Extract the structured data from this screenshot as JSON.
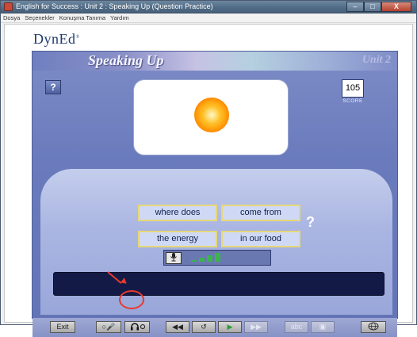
{
  "window": {
    "title": "English for Success : Unit 2 : Speaking Up (Question Practice)",
    "controls": {
      "minimize": "–",
      "maximize": "□",
      "close": "X"
    }
  },
  "menu": {
    "items": [
      "Dosya",
      "Seçenekler",
      "Konuşma Tanıma",
      "Yardım"
    ]
  },
  "brand": {
    "logo": "DynEd",
    "logo_mark": "®"
  },
  "lesson": {
    "title": "Speaking Up",
    "unit": "Unit 2",
    "help_label": "?",
    "score": {
      "value": "105",
      "label": "SCORE"
    },
    "picture": "sun",
    "phrases": [
      "where does",
      "come from",
      "the energy",
      "in our food"
    ],
    "question_mark": "?",
    "voice_level_bars": 4
  },
  "toolbar": {
    "exit_label": "Exit",
    "rewind_label": "◀◀",
    "repeat_label": "↺",
    "play_label": "▶",
    "forward_label": "▶▶",
    "abc_label": "abc",
    "icons": [
      "mic-toggle-icon",
      "headphones-icon",
      "rewind-icon",
      "repeat-icon",
      "play-icon",
      "fast-forward-icon",
      "abc-icon",
      "record-icon",
      "globe-icon"
    ]
  },
  "colors": {
    "accent": "#6375b6",
    "phrase_border": "#e6d879",
    "highlight": "#e63a2e",
    "level_bar": "#39b54a"
  }
}
